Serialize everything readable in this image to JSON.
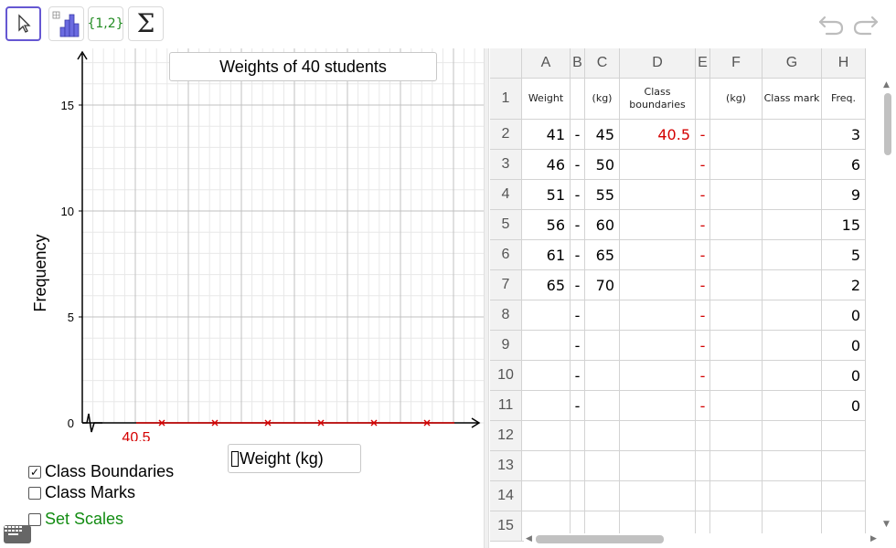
{
  "toolbar": {
    "tools": [
      {
        "name": "move-tool",
        "label": ""
      },
      {
        "name": "histogram-tool",
        "label": ""
      },
      {
        "name": "list-tool",
        "label": "{1,2}"
      },
      {
        "name": "sum-tool",
        "label": "Σ"
      }
    ]
  },
  "graphics": {
    "title": "Weights of 40 students",
    "weight_input": "Weight (kg)",
    "checkboxes": [
      {
        "label": "Class Boundaries",
        "checked": true
      },
      {
        "label": "Class Marks",
        "checked": false
      },
      {
        "label": "Set Scales",
        "checked": false
      }
    ]
  },
  "chart_data": {
    "type": "bar",
    "title": "Weights of 40 students",
    "xlabel": "Weight (kg)",
    "ylabel": "Frequency",
    "ylim": [
      0,
      17
    ],
    "y_ticks": [
      0,
      5,
      10,
      15
    ],
    "x_tick_labels": [
      "40.5"
    ],
    "marker_count": 6,
    "grid": true,
    "marker_color": "#d40000"
  },
  "spreadsheet": {
    "columns": [
      "A",
      "B",
      "C",
      "D",
      "E",
      "F",
      "G",
      "H"
    ],
    "header_row": [
      "Weight",
      "",
      "(kg)",
      "Class boundaries",
      "",
      "(kg)",
      "Class mark",
      "Freq."
    ],
    "rows": [
      {
        "n": "2",
        "a": "41",
        "b": "-",
        "c": "45",
        "d": "40.5",
        "e": "-",
        "h": "3"
      },
      {
        "n": "3",
        "a": "46",
        "b": "-",
        "c": "50",
        "d": "",
        "e": "-",
        "h": "6"
      },
      {
        "n": "4",
        "a": "51",
        "b": "-",
        "c": "55",
        "d": "",
        "e": "-",
        "h": "9"
      },
      {
        "n": "5",
        "a": "56",
        "b": "-",
        "c": "60",
        "d": "",
        "e": "-",
        "h": "15"
      },
      {
        "n": "6",
        "a": "61",
        "b": "-",
        "c": "65",
        "d": "",
        "e": "-",
        "h": "5"
      },
      {
        "n": "7",
        "a": "65",
        "b": "-",
        "c": "70",
        "d": "",
        "e": "-",
        "h": "2"
      },
      {
        "n": "8",
        "a": "",
        "b": "-",
        "c": "",
        "d": "",
        "e": "-",
        "h": "0"
      },
      {
        "n": "9",
        "a": "",
        "b": "-",
        "c": "",
        "d": "",
        "e": "-",
        "h": "0"
      },
      {
        "n": "10",
        "a": "",
        "b": "-",
        "c": "",
        "d": "",
        "e": "-",
        "h": "0"
      },
      {
        "n": "11",
        "a": "",
        "b": "-",
        "c": "",
        "d": "",
        "e": "-",
        "h": "0"
      },
      {
        "n": "12",
        "a": "",
        "b": "",
        "c": "",
        "d": "",
        "e": "",
        "h": ""
      },
      {
        "n": "13",
        "a": "",
        "b": "",
        "c": "",
        "d": "",
        "e": "",
        "h": ""
      },
      {
        "n": "14",
        "a": "",
        "b": "",
        "c": "",
        "d": "",
        "e": "",
        "h": ""
      },
      {
        "n": "15",
        "a": "",
        "b": "",
        "c": "",
        "d": "",
        "e": "",
        "h": ""
      }
    ]
  },
  "colors": {
    "accent": "#6557d2",
    "red": "#d40000",
    "green": "#128c12"
  }
}
